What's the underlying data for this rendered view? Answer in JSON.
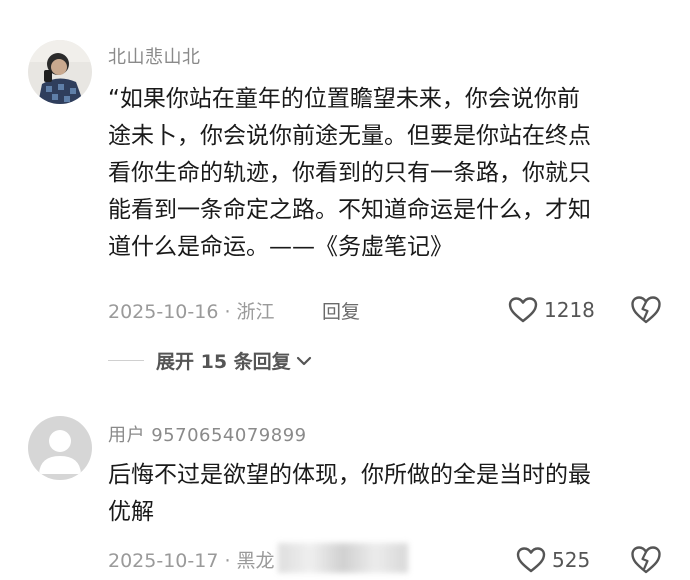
{
  "comments": [
    {
      "username": "北山悲山北",
      "lines": [
        "“如果你站在童年的位置瞻望未来，你会说你前",
        "途未卜，你会说你前途无量。但要是你站在终点",
        "看你生命的轨迹，你看到的只有一条路，你就只",
        "能看到一条命定之路。不知道命运是什么，才知",
        "道什么是命运。——《务虚笔记》"
      ],
      "meta": "2025-10-16 · 浙江",
      "reply_label": "回复",
      "likes": "1218",
      "expand_label": "展开 15 条回复"
    },
    {
      "username": "用户 9570654079899",
      "lines": [
        "后悔不过是欲望的体现，你所做的全是当时的最",
        "优解"
      ],
      "meta": "2025-10-17 · 黑龙",
      "likes": "525"
    }
  ],
  "icons": {
    "like": "heart-outline-icon",
    "dislike": "broken-heart-icon",
    "expand": "chevron-down-icon"
  },
  "colors": {
    "text": "#1a1a1a",
    "muted": "#9a9a9a",
    "icon": "#555555"
  }
}
